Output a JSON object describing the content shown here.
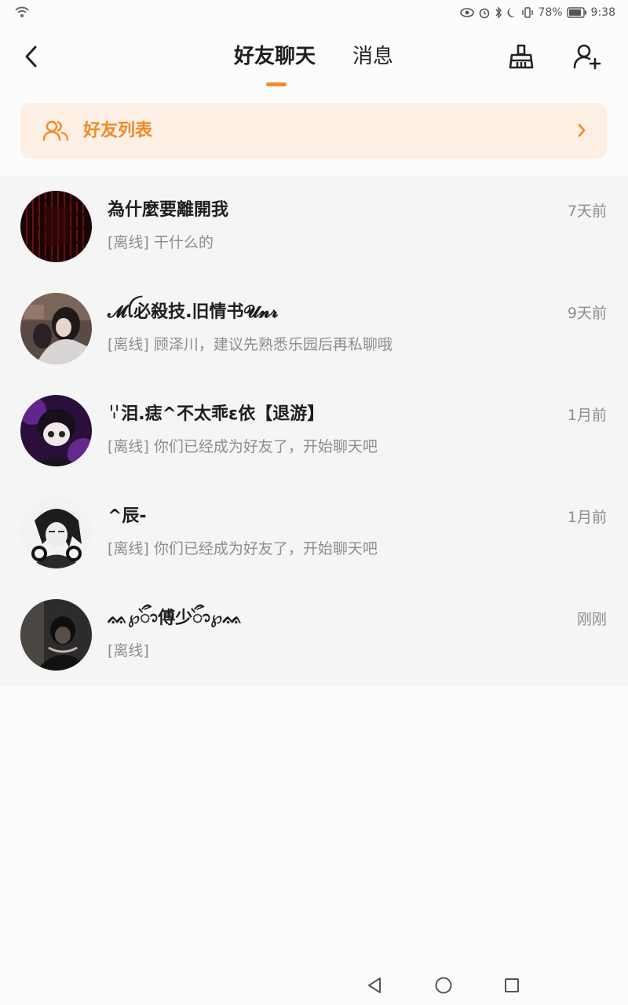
{
  "status_bar": {
    "battery": "78%",
    "time": "9:38"
  },
  "header": {
    "tabs": [
      {
        "label": "好友聊天",
        "active": true
      },
      {
        "label": "消息",
        "active": false
      }
    ]
  },
  "banner": {
    "label": "好友列表"
  },
  "chats": [
    {
      "name": "為什麼要離開我",
      "preview": "[离线] 干什么的",
      "time": "7天前",
      "avatar": "dark-red-pattern"
    },
    {
      "name": "𝓜ꪶ必殺技.旧情书𝓤𝓷𝓻",
      "preview": "[离线] 顾泽川，建议先熟悉乐园后再私聊哦",
      "time": "9天前",
      "avatar": "couple-photo"
    },
    {
      "name": "ꈌ泪.痣^不太乖ε依【退游】",
      "preview": "[离线] 你们已经成为好友了，开始聊天吧",
      "time": "1月前",
      "avatar": "purple-anime"
    },
    {
      "name": "^辰-",
      "preview": "[离线] 你们已经成为好友了，开始聊天吧",
      "time": "1月前",
      "avatar": "anime-boy-headphones"
    },
    {
      "name": "ᨐ℘ᭃ傅少ᭃ℘ᨐ",
      "preview": "[离线]",
      "time": "刚刚",
      "avatar": "dark-boy-photo"
    }
  ],
  "colors": {
    "accent": "#f08a2c",
    "banner_bg": "#fdefe4",
    "list_bg": "#f6f5f6"
  }
}
